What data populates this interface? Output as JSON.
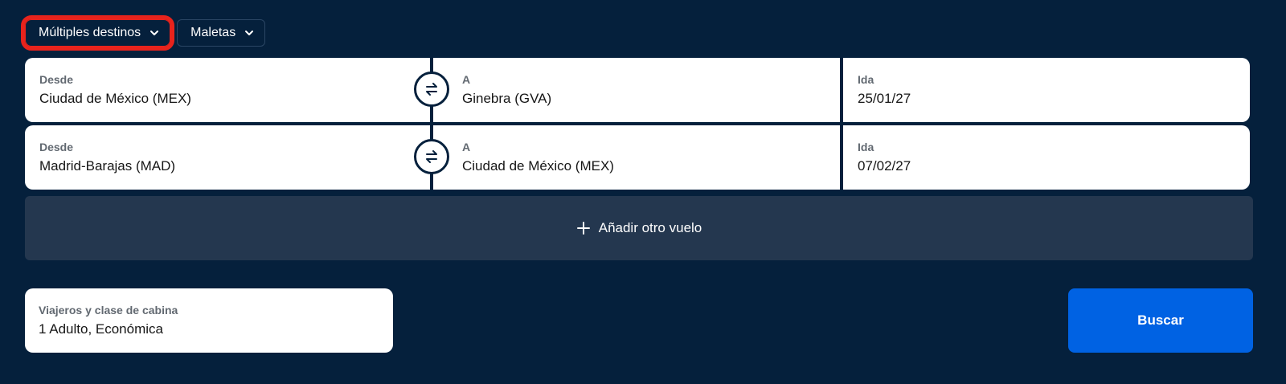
{
  "trip_type": {
    "label": "Múltiples destinos",
    "icon": "chevron-down-icon"
  },
  "bags": {
    "label": "Maletas",
    "icon": "chevron-down-icon"
  },
  "legs": [
    {
      "from_label": "Desde",
      "from_value": "Ciudad de México (MEX)",
      "to_label": "A",
      "to_value": "Ginebra (GVA)",
      "date_label": "Ida",
      "date_value": "25/01/27"
    },
    {
      "from_label": "Desde",
      "from_value": "Madrid-Barajas (MAD)",
      "to_label": "A",
      "to_value": "Ciudad de México (MEX)",
      "date_label": "Ida",
      "date_value": "07/02/27"
    }
  ],
  "add_flight": {
    "label": "Añadir otro vuelo",
    "icon": "plus-icon"
  },
  "travelers": {
    "label": "Viajeros y clase de cabina",
    "value": "1 Adulto, Económica"
  },
  "search": {
    "label": "Buscar"
  },
  "colors": {
    "background": "#05203c",
    "highlight": "#e8231c",
    "primary": "#0062e3",
    "add_bg": "#24374f"
  }
}
